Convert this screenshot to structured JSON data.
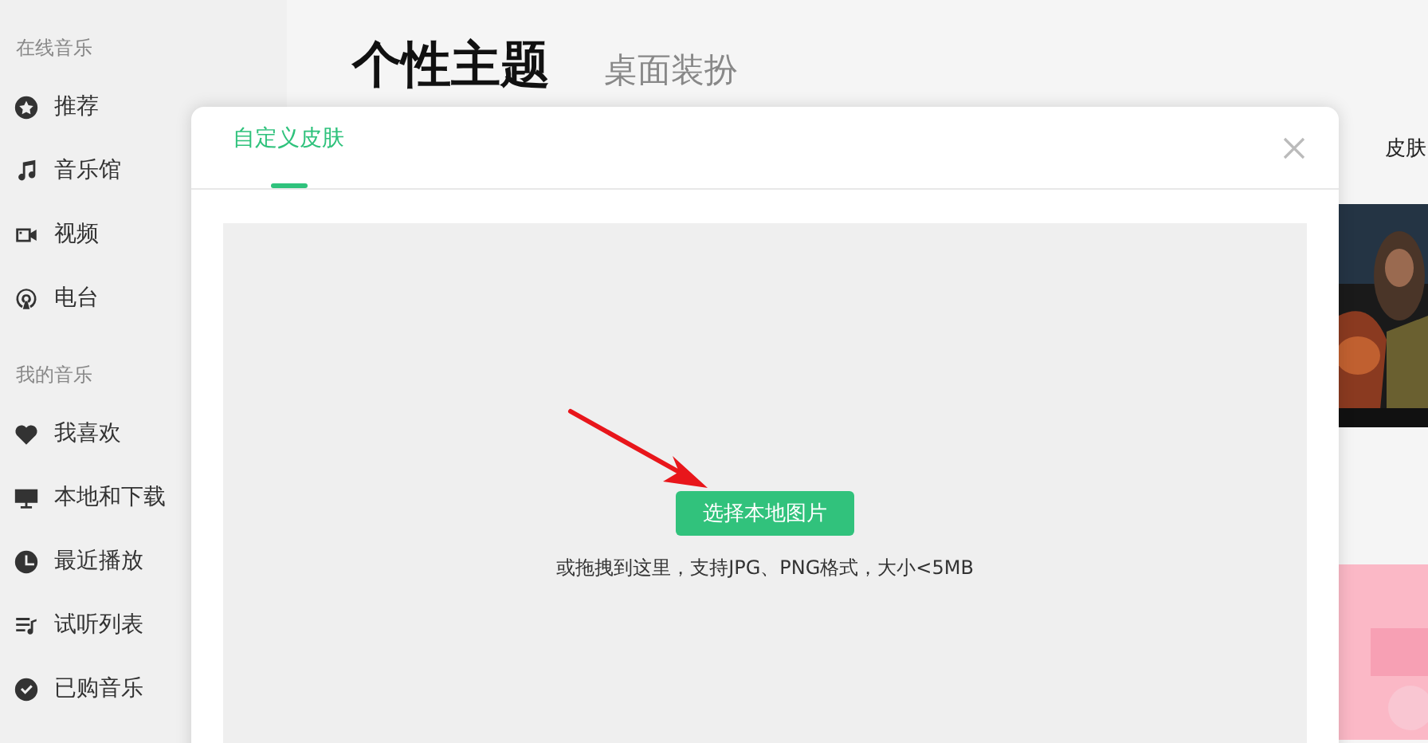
{
  "sidebar": {
    "sections": [
      {
        "title": "在线音乐",
        "items": [
          {
            "label": "推荐"
          },
          {
            "label": "音乐馆"
          },
          {
            "label": "视频"
          },
          {
            "label": "电台"
          }
        ]
      },
      {
        "title": "我的音乐",
        "items": [
          {
            "label": "我喜欢"
          },
          {
            "label": "本地和下载"
          },
          {
            "label": "最近播放"
          },
          {
            "label": "试听列表"
          },
          {
            "label": "已购音乐"
          }
        ]
      }
    ]
  },
  "page": {
    "title": "个性主题",
    "subtitle": "桌面装扮",
    "tab_label": "皮肤"
  },
  "dialog": {
    "tabs": [
      {
        "label": "自定义皮肤",
        "selected": true
      }
    ],
    "upload_button": "选择本地图片",
    "hint": "或拖拽到这里，支持JPG、PNG格式，大小<5MB"
  }
}
